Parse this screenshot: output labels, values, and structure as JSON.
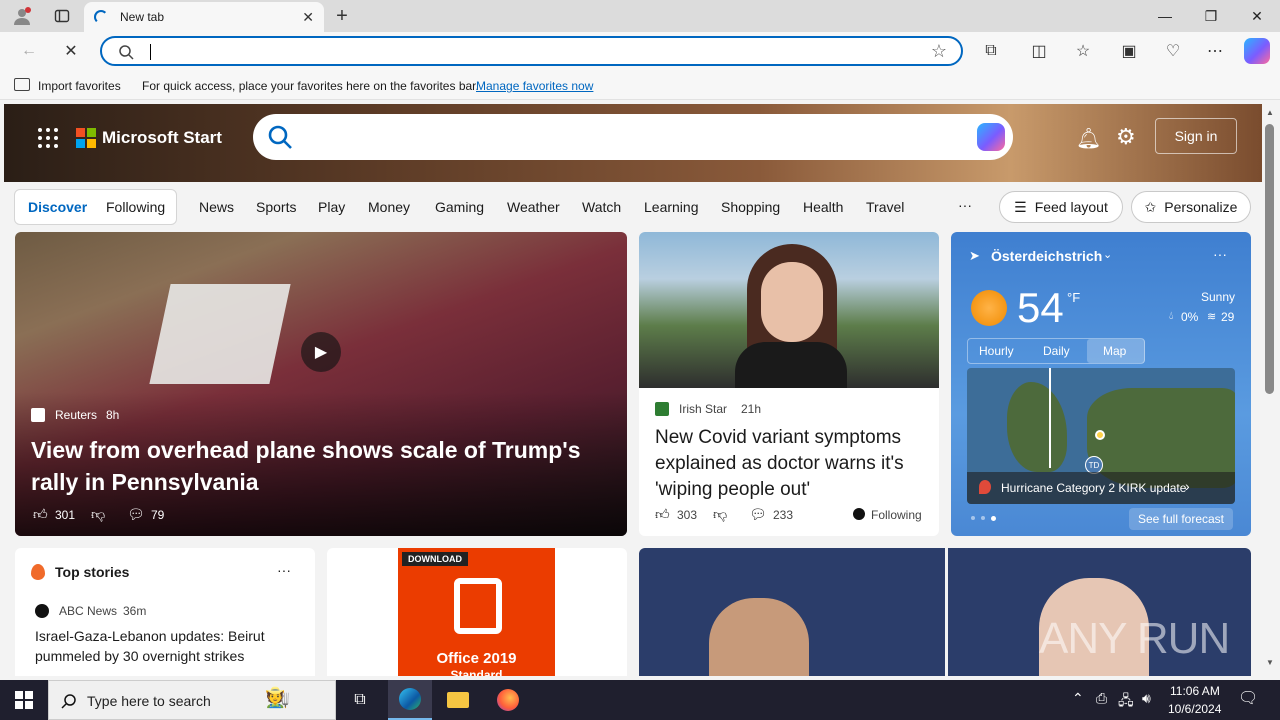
{
  "browser": {
    "tab_title": "New tab",
    "address_value": "",
    "favorites_bar": {
      "import_label": "Import favorites",
      "hint": "For quick access, place your favorites here on the favorites bar.",
      "manage_link": "Manage favorites now"
    }
  },
  "start": {
    "brand": "Microsoft Start",
    "sign_in": "Sign in",
    "tabs": [
      "Discover",
      "Following"
    ],
    "nav": [
      "News",
      "Sports",
      "Play",
      "Money",
      "Gaming",
      "Weather",
      "Watch",
      "Learning",
      "Shopping",
      "Health",
      "Travel"
    ],
    "more": "···",
    "feed_layout": "Feed layout",
    "personalize": "Personalize"
  },
  "hero_story": {
    "source": "Reuters",
    "age": "8h",
    "headline": "View from overhead plane shows scale of Trump's rally in Pennsylvania",
    "likes": "301",
    "comments": "79"
  },
  "story2": {
    "source": "Irish Star",
    "age": "21h",
    "headline": "New Covid variant symptoms explained as doctor warns it's 'wiping people out'",
    "likes": "303",
    "comments": "233",
    "following": "Following"
  },
  "weather": {
    "location": "Österdeichstrich",
    "temp": "54",
    "unit": "°F",
    "condition": "Sunny",
    "precip": "0%",
    "wind": "29",
    "tabs": [
      "Hourly",
      "Daily",
      "Map"
    ],
    "alert": "Hurricane Category 2 KIRK update",
    "forecast_link": "See full forecast",
    "map_badge": "TD"
  },
  "top_stories": {
    "title": "Top stories",
    "source": "ABC News",
    "age": "36m",
    "headline": "Israel-Gaza-Lebanon updates: Beirut pummeled by 30 overnight strikes"
  },
  "ad": {
    "badge": "DOWNLOAD",
    "product": "Office 2019",
    "sub": "Standard"
  },
  "watermark": "ANY RUN",
  "taskbar": {
    "search_placeholder": "Type here to search",
    "time": "11:06 AM",
    "date": "10/6/2024"
  },
  "colors": {
    "accent": "#0067c0",
    "office_red": "#eb3c00",
    "taskbar": "#1f1f2e"
  }
}
